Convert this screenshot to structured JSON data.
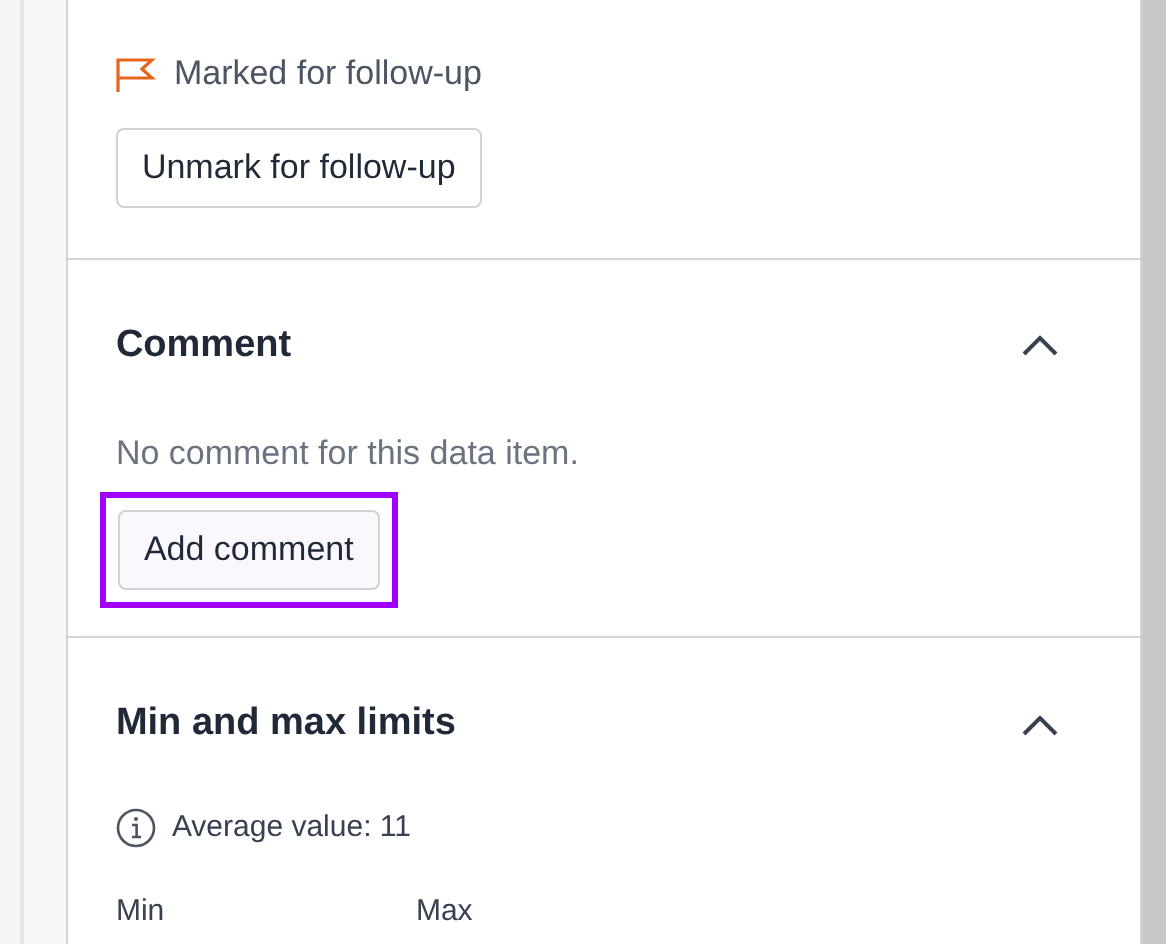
{
  "follow_up": {
    "marked": true,
    "status": "Marked for follow-up",
    "button": "Unmark for follow-up"
  },
  "comment": {
    "title": "Comment",
    "expanded": true,
    "empty_text": "No comment for this data item.",
    "button": {
      "label": "Add comment",
      "highlighted": true
    }
  },
  "limits": {
    "title": "Min and max limits",
    "expanded": true,
    "average": "Average value: 11",
    "fields": [
      {
        "label": "Min"
      },
      {
        "label": "Max"
      }
    ]
  }
}
